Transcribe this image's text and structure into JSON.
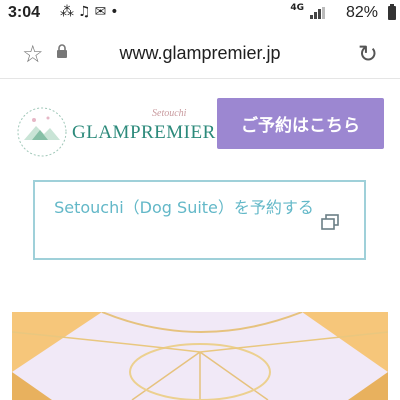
{
  "status_bar": {
    "time": "3:04",
    "notification_icons": [
      "sync-icon",
      "music-icon",
      "mail-icon",
      "dot-icon"
    ],
    "network": "4G",
    "battery": "82%"
  },
  "browser": {
    "url": "www.glampremier.jp",
    "icons": [
      "star-icon",
      "lock-icon",
      "reload-icon"
    ]
  },
  "header": {
    "logo_brand": "GLAMPREMIER",
    "logo_sub": "Setouchi",
    "reserve_label": "ご予約はこちら"
  },
  "suite_link": {
    "label": "Setouchi（Dog Suite）を予約する"
  },
  "colors": {
    "reserve_button": "#9c87d1",
    "suite_border": "#9fd0d9",
    "suite_text": "#63b8c8",
    "brand_green": "#2c8a7b"
  }
}
